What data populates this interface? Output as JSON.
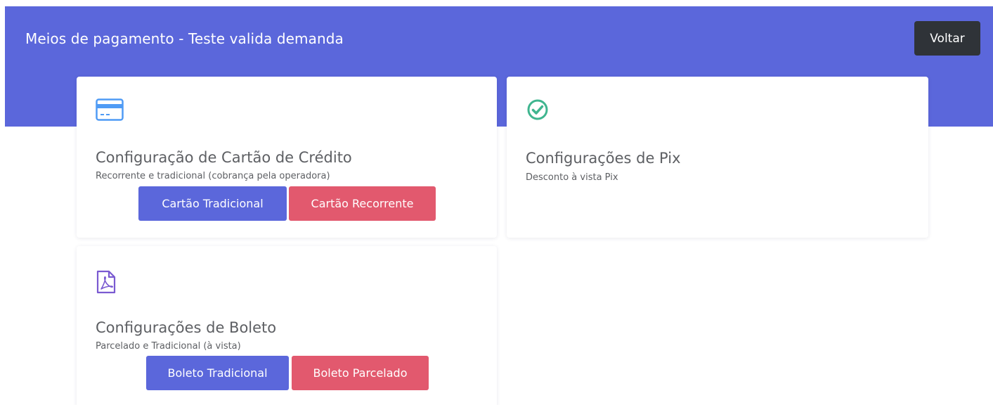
{
  "header": {
    "title": "Meios de pagamento - Teste valida demanda",
    "back_label": "Voltar"
  },
  "cards": {
    "credit": {
      "icon": "credit-card-icon",
      "title": "Configuração de Cartão de Crédito",
      "subtitle": "Recorrente e tradicional (cobrança pela operadora)",
      "primary_label": "Cartão Tradicional",
      "secondary_label": "Cartão Recorrente"
    },
    "pix": {
      "icon": "check-circle-icon",
      "title": "Configurações de Pix",
      "subtitle": "Desconto à vista Pix"
    },
    "boleto": {
      "icon": "pdf-file-icon",
      "title": "Configurações de Boleto",
      "subtitle": "Parcelado e Tradicional (à vista)",
      "primary_label": "Boleto Tradicional",
      "secondary_label": "Boleto Parcelado"
    }
  },
  "colors": {
    "header_bg": "#5b67db",
    "primary_button": "#5b67db",
    "danger_button": "#e2596e",
    "back_button": "#2f3338",
    "credit_icon": "#4f9bf5",
    "pix_icon": "#3fb58f",
    "boleto_icon": "#7a5ad1"
  }
}
